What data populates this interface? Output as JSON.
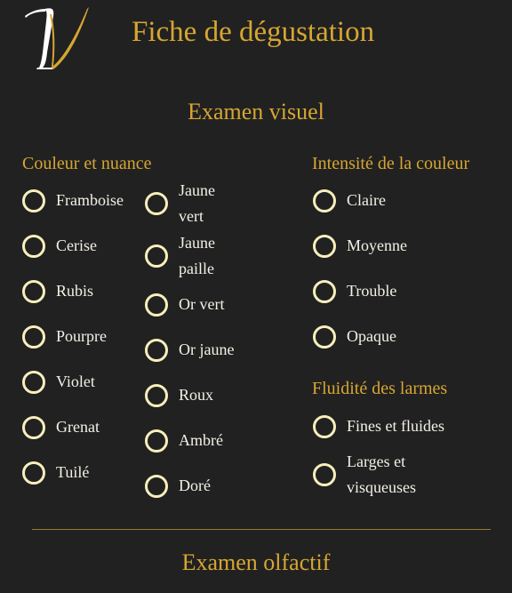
{
  "header": {
    "title": "Fiche de dégustation"
  },
  "visual": {
    "title": "Examen visuel",
    "color_group": {
      "title": "Couleur et nuance",
      "col1": [
        "Framboise",
        "Cerise",
        "Rubis",
        "Pourpre",
        "Violet",
        "Grenat",
        "Tuilé"
      ],
      "col2": [
        "Jaune vert",
        "Jaune paille",
        "Or vert",
        "Or jaune",
        "Roux",
        "Ambré",
        "Doré"
      ]
    },
    "intensity_group": {
      "title": "Intensité de la couleur",
      "options": [
        "Claire",
        "Moyenne",
        "Trouble",
        "Opaque"
      ]
    },
    "tears_group": {
      "title": "Fluidité des larmes",
      "options": [
        "Fines et fluides",
        "Larges et visqueuses"
      ]
    }
  },
  "olfactory": {
    "title": "Examen olfactif"
  },
  "colors": {
    "accent": "#d6a632",
    "radio_ring": "#f8efbc",
    "background": "#212121"
  }
}
